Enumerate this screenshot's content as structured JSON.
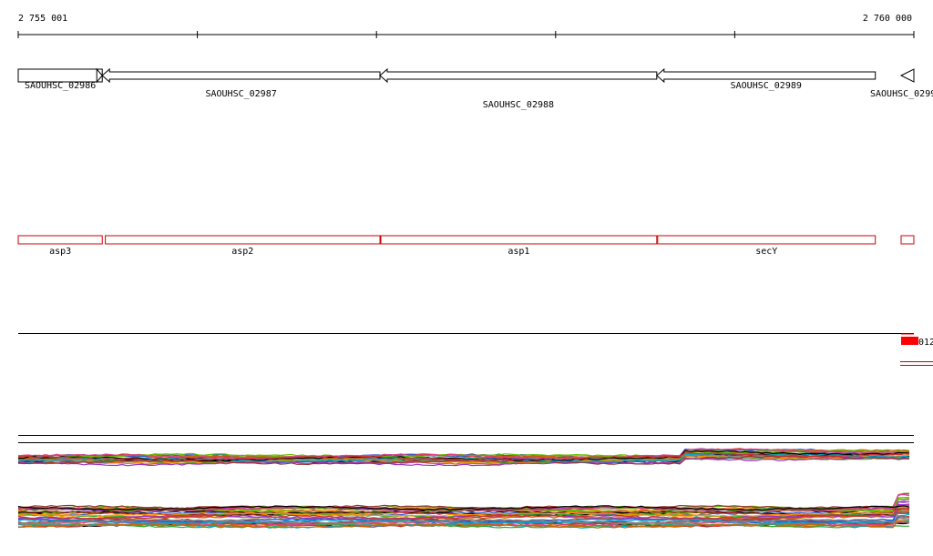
{
  "ruler": {
    "start_label": "2 755 001",
    "end_label": "2 760 000",
    "start": 2755001,
    "end": 2760000
  },
  "gene_track": {
    "color": "#000000",
    "genes": [
      {
        "label": "SAOUHSC_02986",
        "start": 2755001,
        "end": 2755470,
        "strand": "-"
      },
      {
        "label": "SAOUHSC_02987",
        "start": 2755470,
        "end": 2757020,
        "strand": "-"
      },
      {
        "label": "SAOUHSC_02988",
        "start": 2757020,
        "end": 2758565,
        "strand": "-"
      },
      {
        "label": "SAOUHSC_02989",
        "start": 2758565,
        "end": 2759785,
        "strand": "-"
      },
      {
        "label": "SAOUHSC_0299",
        "start": 2759925,
        "end": 2760000,
        "strand": "-"
      }
    ]
  },
  "name_track": {
    "color": "#cc0000",
    "features": [
      {
        "label": "asp3",
        "start": 2755001,
        "end": 2755470
      },
      {
        "label": "asp2",
        "start": 2755487,
        "end": 2757020
      },
      {
        "label": "asp1",
        "start": 2757025,
        "end": 2758565
      },
      {
        "label": "secY",
        "start": 2758570,
        "end": 2759785
      },
      {
        "label": "",
        "start": 2759925,
        "end": 2760000
      }
    ]
  },
  "marker_track": {
    "label": "012",
    "color": "#ff0000"
  },
  "signal_colors": [
    "#000000",
    "#cc3333",
    "#3355cc",
    "#33aa33",
    "#ff9900",
    "#9933cc",
    "#888888",
    "#cc6600",
    "#66bb00",
    "#993333",
    "#00aacc",
    "#dd4488"
  ]
}
